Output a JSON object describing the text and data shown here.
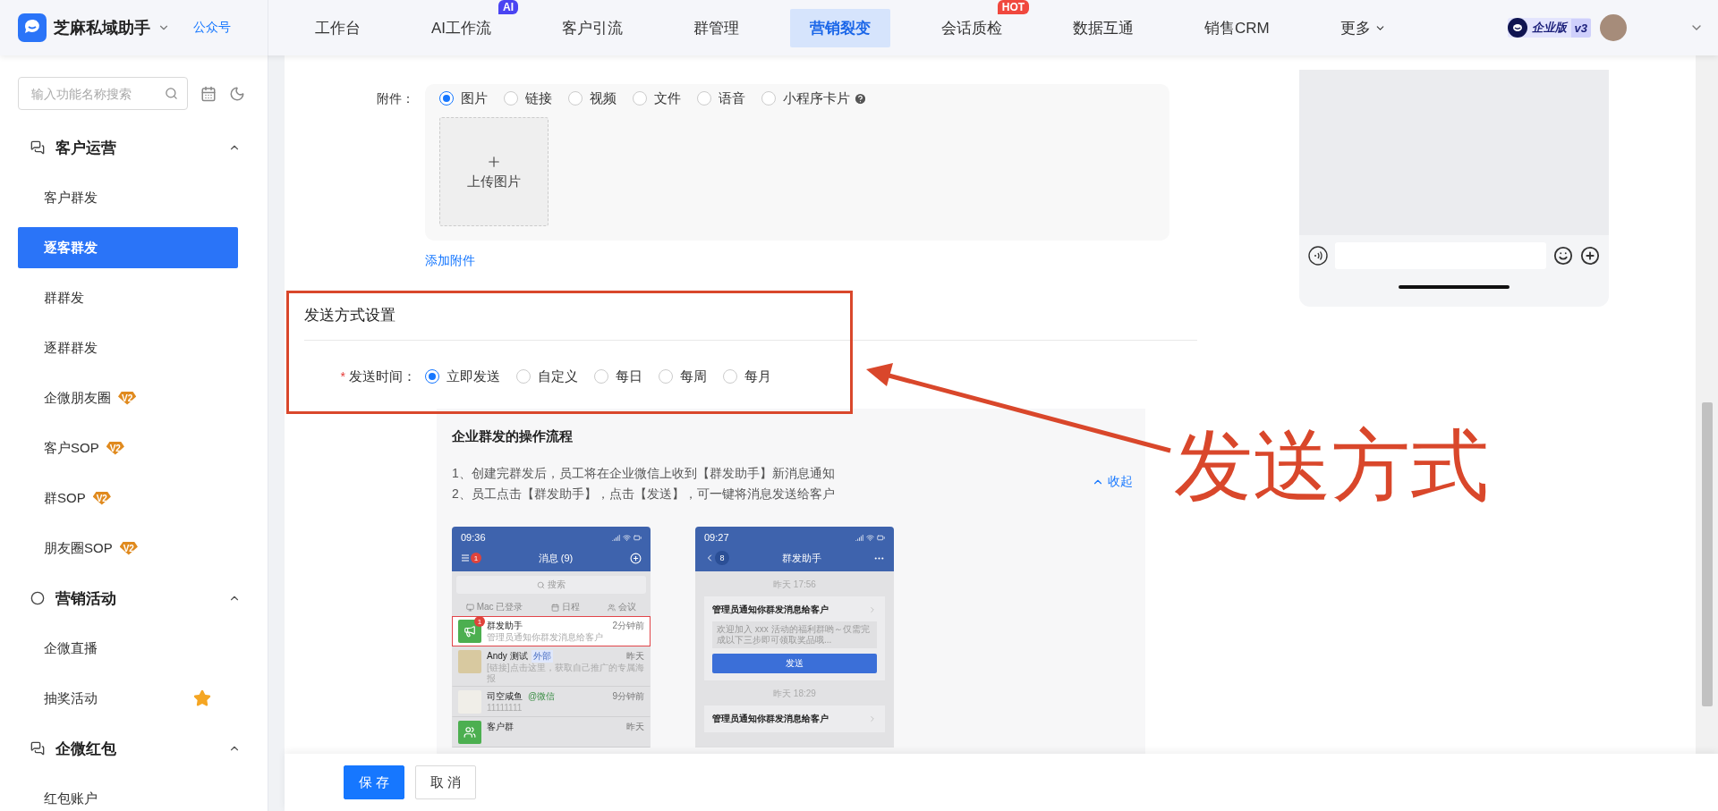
{
  "header": {
    "app_name": "芝麻私域助手",
    "account_link": "公众号",
    "nav": [
      {
        "label": "工作台",
        "selected": false
      },
      {
        "label": "AI工作流",
        "selected": false,
        "badge": "AI",
        "color": "#4a44f2"
      },
      {
        "label": "客户引流",
        "selected": false
      },
      {
        "label": "群管理",
        "selected": false
      },
      {
        "label": "营销裂变",
        "selected": true
      },
      {
        "label": "会话质检",
        "selected": false,
        "badge": "HOT",
        "color": "#f0483e"
      },
      {
        "label": "数据互通",
        "selected": false
      },
      {
        "label": "销售CRM",
        "selected": false
      },
      {
        "label": "更多",
        "selected": false,
        "dropdown": true
      }
    ],
    "edition": {
      "label": "企业版",
      "version": "v3"
    }
  },
  "sidebar": {
    "search": {
      "placeholder": "输入功能名称搜索"
    },
    "groups": [
      {
        "title": "客户运营",
        "expanded": true,
        "items": [
          {
            "label": "客户群发",
            "selected": false
          },
          {
            "label": "逐客群发",
            "selected": true
          },
          {
            "label": "群群发",
            "selected": false
          },
          {
            "label": "逐群群发",
            "selected": false
          },
          {
            "label": "企微朋友圈",
            "selected": false,
            "tag": "V2"
          },
          {
            "label": "客户SOP",
            "selected": false,
            "tag": "V2"
          },
          {
            "label": "群SOP",
            "selected": false,
            "tag": "V2"
          },
          {
            "label": "朋友圈SOP",
            "selected": false,
            "tag": "V2"
          }
        ]
      },
      {
        "title": "营销活动",
        "expanded": true,
        "items": [
          {
            "label": "企微直播",
            "selected": false
          },
          {
            "label": "抽奖活动",
            "selected": false,
            "starred": true
          }
        ]
      },
      {
        "title": "企微红包",
        "expanded": true,
        "items": [
          {
            "label": "红包账户",
            "selected": false
          }
        ]
      }
    ]
  },
  "attachment": {
    "label": "附件：",
    "options": [
      {
        "label": "图片",
        "selected": true
      },
      {
        "label": "链接",
        "selected": false
      },
      {
        "label": "视频",
        "selected": false
      },
      {
        "label": "文件",
        "selected": false
      },
      {
        "label": "语音",
        "selected": false
      },
      {
        "label": "小程序卡片",
        "selected": false,
        "help": true
      }
    ],
    "upload_label": "上传图片",
    "add_link": "添加附件"
  },
  "send_settings": {
    "title": "发送方式设置",
    "required_mark": "*",
    "field_label": "发送时间：",
    "options": [
      {
        "label": "立即发送",
        "selected": true
      },
      {
        "label": "自定义",
        "selected": false
      },
      {
        "label": "每日",
        "selected": false
      },
      {
        "label": "每周",
        "selected": false
      },
      {
        "label": "每月",
        "selected": false
      }
    ]
  },
  "guide": {
    "title": "企业群发的操作流程",
    "steps": [
      "1、创建完群发后，员工将在企业微信上收到【群发助手】新消息通知",
      "2、员工点击【群发助手】，点击【发送】，可一键将消息发送给客户"
    ],
    "collapse": "收起",
    "phones": [
      {
        "kind": "chat_list",
        "time": "09:36",
        "title": "消息 (9)",
        "menu_badge": "1",
        "search": "搜索",
        "quick": [
          "Mac 已登录",
          "日程",
          "会议"
        ],
        "chats": [
          {
            "name": "群发助手",
            "preview": "管理员通知你群发消息给客户",
            "time": "2分钟前",
            "badge": "1",
            "highlighted": true
          },
          {
            "name": "Andy 测试",
            "tag": "外部",
            "preview": "[链接]点击这里，获取自己推广的专属海报",
            "time": "昨天",
            "highlighted": false
          },
          {
            "name": "司空咸鱼",
            "tag": "@微信",
            "preview": "11111111",
            "time": "9分钟前",
            "highlighted": false
          },
          {
            "name": "客户群",
            "time": "昨天",
            "highlighted": false
          }
        ]
      },
      {
        "kind": "assistant",
        "time": "09:27",
        "title": "群发助手",
        "back_badge": "8",
        "messages": [
          {
            "time": "昨天 17:56",
            "title": "管理员通知你群发消息给客户",
            "body": "欢迎加入 xxx 活动的福利群哟～仅需完成以下三步即可领取奖品哦...",
            "button": "发送"
          },
          {
            "time": "昨天 18:29",
            "title": "管理员通知你群发消息给客户"
          }
        ]
      }
    ]
  },
  "footer": {
    "buttons": [
      {
        "label": "保 存",
        "kind": "primary"
      },
      {
        "label": "取 消",
        "kind": "default"
      }
    ]
  },
  "annotation": {
    "label": "发送方式"
  }
}
